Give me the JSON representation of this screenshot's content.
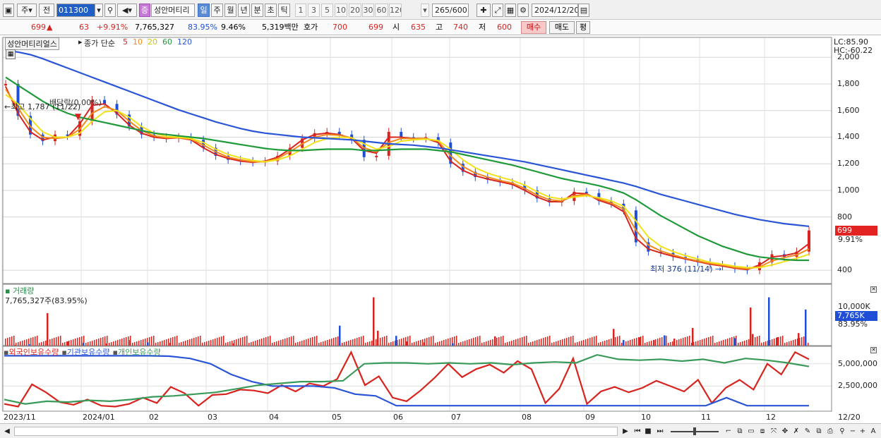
{
  "toolbar": {
    "market": "주",
    "prev": "전",
    "code": "011300",
    "stock_name_badge": "증",
    "stock_name": "성안머티리",
    "periods": [
      "일",
      "주",
      "월",
      "년",
      "분",
      "초",
      "틱"
    ],
    "selected_period": "일",
    "intervals": [
      "1",
      "3",
      "5",
      "10",
      "20",
      "30",
      "60",
      "120"
    ],
    "count_current": "265",
    "count_total": "/600",
    "date": "2024/12/20"
  },
  "quote": {
    "price": "699",
    "arrow": "▲",
    "change": "63",
    "change_pct": "+9.91%",
    "volume": "7,765,327",
    "volume_ratio": "83.95%",
    "turnover": "9.46%",
    "amount": "5,319백만",
    "hoga_label": "호가",
    "ask": "700",
    "bid": "699",
    "open_label": "시",
    "open": "635",
    "high_label": "고",
    "high": "740",
    "low_label": "저",
    "low": "600",
    "buy": "매수",
    "sell": "매도",
    "flat": "평"
  },
  "price_panel": {
    "stock_label": "성안머티리얼스",
    "ma_title": "종가 단순",
    "ma_periods": [
      "5",
      "10",
      "20",
      "60",
      "120"
    ],
    "ma_colors": [
      "#d8241f",
      "#f08a1d",
      "#f2e21a",
      "#1f9a3a",
      "#2a55d6"
    ],
    "lc": "LC:85.90",
    "hc": "HC:-60.22",
    "y_ticks": [
      "2,000",
      "1,800",
      "1,600",
      "1,400",
      "1,200",
      "1,000",
      "800",
      "400"
    ],
    "price_tag": "699",
    "price_tag_pct": "9.91%",
    "high_note": "최고 1,787 (11/22)",
    "dividend_note": "배당락(0.00%)",
    "low_note": "최저 376 (11/14)"
  },
  "volume_panel": {
    "title": "거래량",
    "value": "7,765,327주(83.95%)",
    "y_tick": "10,000K",
    "tag": "7,765K",
    "tag_pct": "83.95%"
  },
  "holdings_panel": {
    "series": [
      "외국인보유수량",
      "기관보유수량",
      "개인보유수량"
    ],
    "colors": [
      "#d8241f",
      "#2a55d6",
      "#3a9a5a"
    ],
    "y_ticks": [
      "5,000,000",
      "2,500,000"
    ]
  },
  "x_axis": {
    "labels": [
      "2023/11",
      "2024/01",
      "02",
      "03",
      "04",
      "05",
      "06",
      "07",
      "08",
      "09",
      "10",
      "11",
      "12",
      "12/20"
    ]
  },
  "chart_data": {
    "type": "line",
    "title": "",
    "x_labels": [
      "2023/11",
      "2024/01",
      "02",
      "03",
      "04",
      "05",
      "06",
      "07",
      "08",
      "09",
      "10",
      "11",
      "12"
    ],
    "price_series": [
      1800,
      1560,
      1420,
      1370,
      1420,
      1410,
      1520,
      1680,
      1650,
      1570,
      1480,
      1420,
      1400,
      1390,
      1400,
      1380,
      1320,
      1260,
      1230,
      1220,
      1210,
      1220,
      1260,
      1320,
      1390,
      1430,
      1440,
      1420,
      1380,
      1250,
      1260,
      1440,
      1400,
      1390,
      1400,
      1360,
      1200,
      1140,
      1100,
      1080,
      1060,
      1040,
      1000,
      940,
      910,
      920,
      990,
      980,
      920,
      900,
      850,
      610,
      540,
      530,
      500,
      480,
      460,
      440,
      430,
      410,
      400,
      460,
      520,
      500,
      540,
      699
    ],
    "ma_series": [
      {
        "name": "5",
        "values": [
          1780,
          1580,
          1440,
          1380,
          1400,
          1400,
          1500,
          1640,
          1650,
          1580,
          1490,
          1430,
          1400,
          1390,
          1395,
          1380,
          1320,
          1270,
          1240,
          1220,
          1210,
          1220,
          1250,
          1310,
          1380,
          1420,
          1430,
          1420,
          1390,
          1300,
          1280,
          1400,
          1400,
          1390,
          1390,
          1360,
          1220,
          1150,
          1110,
          1085,
          1065,
          1045,
          1000,
          950,
          915,
          915,
          980,
          975,
          925,
          895,
          840,
          640,
          560,
          530,
          505,
          485,
          465,
          445,
          432,
          415,
          405,
          440,
          500,
          510,
          530,
          600
        ]
      },
      {
        "name": "10",
        "values": [
          1760,
          1620,
          1480,
          1400,
          1390,
          1400,
          1460,
          1580,
          1630,
          1600,
          1520,
          1450,
          1410,
          1395,
          1395,
          1385,
          1340,
          1290,
          1250,
          1230,
          1215,
          1215,
          1240,
          1290,
          1350,
          1400,
          1420,
          1415,
          1395,
          1320,
          1290,
          1360,
          1390,
          1390,
          1390,
          1370,
          1260,
          1180,
          1130,
          1100,
          1075,
          1055,
          1015,
          965,
          930,
          920,
          960,
          970,
          935,
          905,
          860,
          700,
          590,
          545,
          515,
          490,
          470,
          450,
          438,
          420,
          410,
          425,
          470,
          495,
          515,
          560
        ]
      },
      {
        "name": "20",
        "values": [
          1720,
          1650,
          1540,
          1440,
          1400,
          1400,
          1430,
          1520,
          1590,
          1600,
          1550,
          1480,
          1430,
          1405,
          1400,
          1390,
          1360,
          1310,
          1270,
          1245,
          1225,
          1215,
          1230,
          1260,
          1310,
          1360,
          1390,
          1400,
          1395,
          1350,
          1310,
          1330,
          1370,
          1380,
          1385,
          1375,
          1310,
          1230,
          1170,
          1130,
          1100,
          1075,
          1040,
          990,
          950,
          935,
          950,
          960,
          945,
          920,
          880,
          770,
          650,
          580,
          540,
          510,
          485,
          460,
          445,
          430,
          420,
          420,
          440,
          465,
          490,
          520
        ]
      },
      {
        "name": "60",
        "values": [
          1850,
          1790,
          1730,
          1670,
          1620,
          1580,
          1550,
          1530,
          1510,
          1490,
          1470,
          1450,
          1430,
          1420,
          1410,
          1400,
          1390,
          1375,
          1360,
          1345,
          1330,
          1315,
          1305,
          1300,
          1300,
          1305,
          1310,
          1310,
          1310,
          1300,
          1300,
          1305,
          1310,
          1310,
          1310,
          1300,
          1290,
          1270,
          1250,
          1230,
          1210,
          1190,
          1165,
          1140,
          1115,
          1090,
          1070,
          1055,
          1035,
          1010,
          980,
          930,
          870,
          810,
          760,
          710,
          660,
          620,
          580,
          550,
          520,
          500,
          490,
          480,
          475,
          475
        ]
      },
      {
        "name": "120",
        "values": [
          2050,
          2040,
          2020,
          1990,
          1955,
          1920,
          1885,
          1850,
          1815,
          1780,
          1745,
          1710,
          1675,
          1640,
          1605,
          1575,
          1545,
          1515,
          1490,
          1465,
          1445,
          1430,
          1420,
          1410,
          1400,
          1395,
          1390,
          1385,
          1380,
          1370,
          1360,
          1350,
          1345,
          1340,
          1330,
          1320,
          1305,
          1290,
          1275,
          1260,
          1245,
          1230,
          1215,
          1195,
          1175,
          1155,
          1135,
          1115,
          1095,
          1075,
          1055,
          1030,
          1000,
          970,
          945,
          920,
          895,
          870,
          845,
          820,
          800,
          780,
          765,
          750,
          740,
          730
        ]
      }
    ],
    "ylim": [
      300,
      2150
    ],
    "volume_spikes_k": [
      120,
      300,
      7000,
      900,
      600,
      450,
      1200,
      700,
      600,
      500,
      4300,
      10400,
      3200,
      2100,
      900,
      700,
      500,
      2000,
      3600,
      1200,
      1800,
      1200,
      2200,
      1500,
      3800,
      1600,
      8200,
      2500,
      10400,
      1800,
      2700,
      7765
    ],
    "holdings": [
      {
        "name": "외국인보유수량",
        "values": [
          500000,
          200000,
          2700000,
          1800000,
          700000,
          400000,
          1000000,
          300000,
          200000,
          500000,
          1200000,
          600000,
          2400000,
          1700000,
          300000,
          1500000,
          1600000,
          2100000,
          2000000,
          1700000,
          2600000,
          1900000,
          2800000,
          2500000,
          3300000,
          6300000,
          2600000,
          3600000,
          1200000,
          800000,
          2000000,
          3400000,
          5000000,
          3500000,
          4400000,
          4900000,
          4000000,
          5300000,
          4400000,
          600000,
          2200000,
          5600000,
          500000,
          1900000,
          2400000,
          1800000,
          2300000,
          3100000,
          2500000,
          1900000,
          3200000,
          600000,
          2300000,
          3200000,
          2100000,
          5000000,
          3800000,
          6300000,
          5500000
        ]
      },
      {
        "name": "기관보유수량",
        "values": [
          5900000,
          5900000,
          5900000,
          5900000,
          5900000,
          5900000,
          5900000,
          5900000,
          5850000,
          5600000,
          5000000,
          3800000,
          3000000,
          2500000,
          2500000,
          2500000,
          2300000,
          1600000,
          1400000,
          300000,
          300000,
          300000,
          300000,
          300000,
          300000,
          300000,
          300000,
          300000,
          300000,
          300000,
          300000,
          300000,
          300000,
          300000,
          300000,
          1200000,
          300000,
          300000,
          300000,
          300000
        ]
      },
      {
        "name": "개인보유수량",
        "values": [
          1000000,
          500000,
          800000,
          700000,
          900000,
          800000,
          1000000,
          1300000,
          1400000,
          1600000,
          1800000,
          2200000,
          2600000,
          2800000,
          3000000,
          3000000,
          3100000,
          5000000,
          5100000,
          5100000,
          5000000,
          5100000,
          5000000,
          5100000,
          4900000,
          5100000,
          5200000,
          5100000,
          6000000,
          5500000,
          5400000,
          5500000,
          5300000,
          5500000,
          5100000,
          5600000,
          5400000,
          5100000,
          4700000
        ]
      }
    ]
  }
}
